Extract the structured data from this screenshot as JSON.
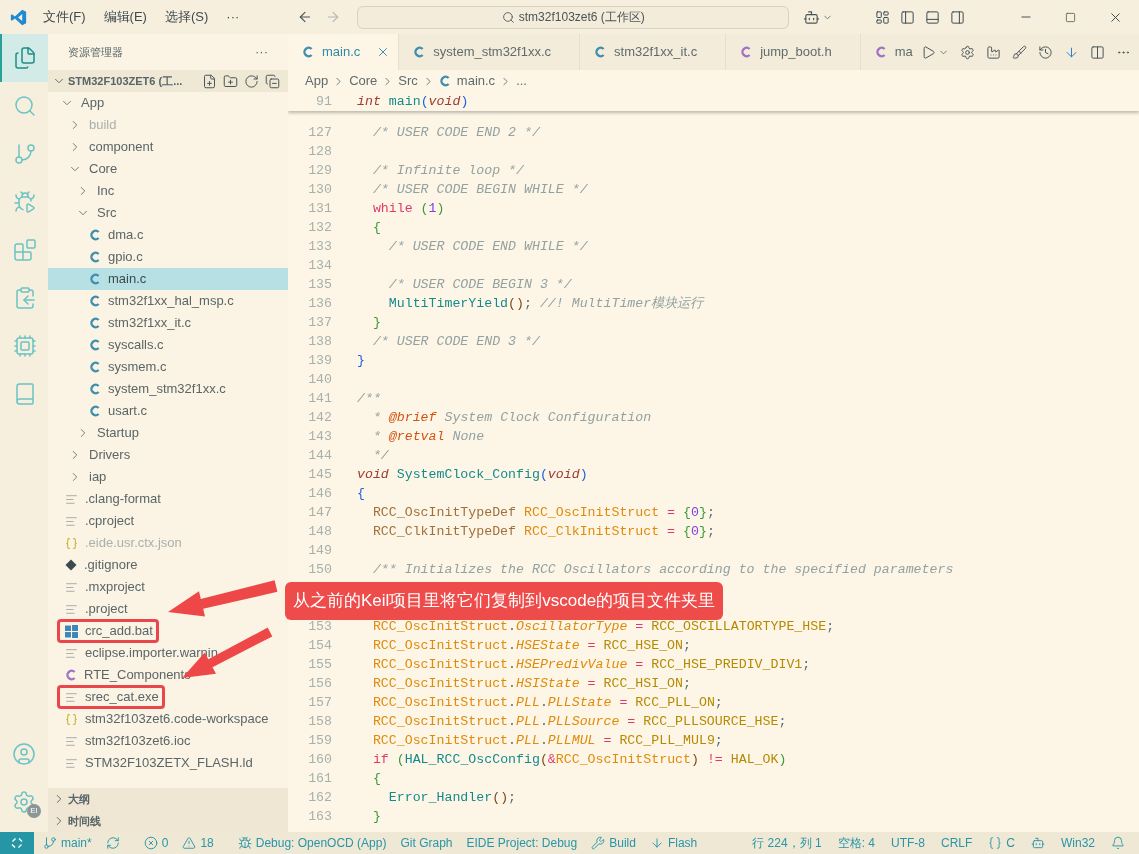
{
  "title_bar": {
    "menus": [
      "文件(F)",
      "编辑(E)",
      "选择(S)",
      "···"
    ],
    "search": "stm32f103zet6 (工作区)"
  },
  "activity_bar": [
    {
      "kind": "explorer",
      "selected": true
    },
    {
      "kind": "search",
      "selected": false
    },
    {
      "kind": "source-control",
      "selected": false
    },
    {
      "kind": "run-debug",
      "selected": false
    },
    {
      "kind": "extensions",
      "selected": false
    },
    {
      "kind": "transfer",
      "selected": false
    },
    {
      "kind": "chip",
      "selected": false
    },
    {
      "kind": "book",
      "selected": false
    }
  ],
  "activity_bottom": [
    {
      "kind": "account"
    },
    {
      "kind": "settings",
      "badge": "EI"
    }
  ],
  "sidebar": {
    "title": "资源管理器",
    "more": "···",
    "project": "STM32F103ZET6 (工...",
    "tree": [
      {
        "label": "App",
        "kind": "folder",
        "expanded": true,
        "selected": false,
        "dimmed": false,
        "highlighted": false,
        "children": [
          {
            "label": "build",
            "kind": "folder",
            "expanded": false,
            "selected": false,
            "dimmed": true,
            "highlighted": false
          },
          {
            "label": "component",
            "kind": "folder",
            "expanded": false,
            "selected": false,
            "dimmed": false,
            "highlighted": false
          },
          {
            "label": "Core",
            "kind": "folder",
            "expanded": true,
            "selected": false,
            "dimmed": false,
            "highlighted": false,
            "children": [
              {
                "label": "Inc",
                "kind": "folder",
                "expanded": false,
                "selected": false,
                "dimmed": false,
                "highlighted": false
              },
              {
                "label": "Src",
                "kind": "folder",
                "expanded": true,
                "selected": false,
                "dimmed": false,
                "highlighted": false,
                "children": [
                  {
                    "label": "dma.c",
                    "kind": "c",
                    "selected": false,
                    "dimmed": false,
                    "highlighted": false
                  },
                  {
                    "label": "gpio.c",
                    "kind": "c",
                    "selected": false,
                    "dimmed": false,
                    "highlighted": false
                  },
                  {
                    "label": "main.c",
                    "kind": "c",
                    "selected": true,
                    "dimmed": false,
                    "highlighted": false
                  },
                  {
                    "label": "stm32f1xx_hal_msp.c",
                    "kind": "c",
                    "selected": false,
                    "dimmed": false,
                    "highlighted": false
                  },
                  {
                    "label": "stm32f1xx_it.c",
                    "kind": "c",
                    "selected": false,
                    "dimmed": false,
                    "highlighted": false
                  },
                  {
                    "label": "syscalls.c",
                    "kind": "c",
                    "selected": false,
                    "dimmed": false,
                    "highlighted": false
                  },
                  {
                    "label": "sysmem.c",
                    "kind": "c",
                    "selected": false,
                    "dimmed": false,
                    "highlighted": false
                  },
                  {
                    "label": "system_stm32f1xx.c",
                    "kind": "c",
                    "selected": false,
                    "dimmed": false,
                    "highlighted": false
                  },
                  {
                    "label": "usart.c",
                    "kind": "c",
                    "selected": false,
                    "dimmed": false,
                    "highlighted": false
                  }
                ]
              },
              {
                "label": "Startup",
                "kind": "folder",
                "expanded": false,
                "selected": false,
                "dimmed": false,
                "highlighted": false
              }
            ]
          },
          {
            "label": "Drivers",
            "kind": "folder",
            "expanded": false,
            "selected": false,
            "dimmed": false,
            "highlighted": false
          },
          {
            "label": "iap",
            "kind": "folder",
            "expanded": false,
            "selected": false,
            "dimmed": false,
            "highlighted": false
          }
        ]
      },
      {
        "label": ".clang-format",
        "kind": "text",
        "selected": false,
        "dimmed": false,
        "highlighted": false
      },
      {
        "label": ".cproject",
        "kind": "text",
        "selected": false,
        "dimmed": false,
        "highlighted": false
      },
      {
        "label": ".eide.usr.ctx.json",
        "kind": "json",
        "selected": false,
        "dimmed": true,
        "highlighted": false
      },
      {
        "label": ".gitignore",
        "kind": "git",
        "selected": false,
        "dimmed": false,
        "highlighted": false
      },
      {
        "label": ".mxproject",
        "kind": "text",
        "selected": false,
        "dimmed": false,
        "highlighted": false
      },
      {
        "label": ".project",
        "kind": "text",
        "selected": false,
        "dimmed": false,
        "highlighted": false
      },
      {
        "label": "crc_add.bat",
        "kind": "windows",
        "selected": false,
        "dimmed": false,
        "highlighted": true
      },
      {
        "label": "eclipse.importer.warnin",
        "kind": "text",
        "selected": false,
        "dimmed": false,
        "highlighted": false
      },
      {
        "label": "RTE_Components",
        "kind": "h",
        "selected": false,
        "dimmed": false,
        "highlighted": false
      },
      {
        "label": "srec_cat.exe",
        "kind": "text",
        "selected": false,
        "dimmed": false,
        "highlighted": true
      },
      {
        "label": "stm32f103zet6.code-workspace",
        "kind": "json",
        "selected": false,
        "dimmed": false,
        "highlighted": false
      },
      {
        "label": "stm32f103zet6.ioc",
        "kind": "text",
        "selected": false,
        "dimmed": false,
        "highlighted": false
      },
      {
        "label": "STM32F103ZETX_FLASH.ld",
        "kind": "text",
        "selected": false,
        "dimmed": false,
        "highlighted": false
      }
    ],
    "sections": [
      {
        "label": "大纲",
        "expanded": false
      },
      {
        "label": "时间线",
        "expanded": false
      }
    ]
  },
  "tabs": [
    {
      "label": "main.c",
      "kind": "c",
      "selected": true
    },
    {
      "label": "system_stm32f1xx.c",
      "kind": "c",
      "selected": false
    },
    {
      "label": "stm32f1xx_it.c",
      "kind": "c",
      "selected": false
    },
    {
      "label": "jump_boot.h",
      "kind": "h",
      "selected": false
    },
    {
      "label": "ma",
      "kind": "h",
      "selected": false
    }
  ],
  "breadcrumbs": [
    {
      "label": "App",
      "kind": "folder"
    },
    {
      "label": "Core",
      "kind": "folder"
    },
    {
      "label": "Src",
      "kind": "folder"
    },
    {
      "label": "main.c",
      "kind": "c"
    },
    {
      "label": "...",
      "kind": "folder"
    }
  ],
  "editor": {
    "sticky": {
      "number": "91",
      "tokens": [
        {
          "text": "int",
          "kind": "storage"
        },
        {
          "text": " main",
          "kind": "function"
        },
        {
          "text": "(",
          "kind": "bracket1"
        },
        {
          "text": "void",
          "kind": "storage"
        },
        {
          "text": ")",
          "kind": "bracket1"
        }
      ]
    },
    "lines": [
      {
        "number": "127",
        "tokens": [
          {
            "text": "  /* USER CODE END 2 */",
            "kind": "comment"
          }
        ]
      },
      {
        "number": "128"
      },
      {
        "number": "129",
        "tokens": [
          {
            "text": "  /* Infinite loop */",
            "kind": "comment"
          }
        ]
      },
      {
        "number": "130",
        "tokens": [
          {
            "text": "  /* USER CODE BEGIN WHILE */",
            "kind": "comment"
          }
        ]
      },
      {
        "number": "131",
        "tokens": [
          {
            "text": "  while",
            "kind": "keyword"
          },
          {
            "text": " (",
            "kind": "bracket2"
          },
          {
            "text": "1",
            "kind": "number"
          },
          {
            "text": ")",
            "kind": "bracket2"
          }
        ]
      },
      {
        "number": "132",
        "tokens": [
          {
            "text": "  {",
            "kind": "bracket2"
          }
        ]
      },
      {
        "number": "133",
        "tokens": [
          {
            "text": "    /* USER CODE END WHILE */",
            "kind": "comment"
          }
        ]
      },
      {
        "number": "134"
      },
      {
        "number": "135",
        "tokens": [
          {
            "text": "    /* USER CODE BEGIN 3 */",
            "kind": "comment"
          }
        ]
      },
      {
        "number": "136",
        "tokens": [
          {
            "text": "    MultiTimerYield",
            "kind": "function"
          },
          {
            "text": "()",
            "kind": "bracket3"
          },
          {
            "text": ";",
            "kind": "plain"
          },
          {
            "text": " //! MultiTimer模块运行",
            "kind": "comment"
          }
        ]
      },
      {
        "number": "137",
        "tokens": [
          {
            "text": "  }",
            "kind": "bracket2"
          }
        ]
      },
      {
        "number": "138",
        "tokens": [
          {
            "text": "  /* USER CODE END 3 */",
            "kind": "comment"
          }
        ]
      },
      {
        "number": "139",
        "tokens": [
          {
            "text": "}",
            "kind": "bracket1"
          }
        ]
      },
      {
        "number": "140"
      },
      {
        "number": "141",
        "tokens": [
          {
            "text": "/**",
            "kind": "comment"
          }
        ]
      },
      {
        "number": "142",
        "tokens": [
          {
            "text": "  * ",
            "kind": "comment"
          },
          {
            "text": "@brief",
            "kind": "doctag"
          },
          {
            "text": " System Clock Configuration",
            "kind": "comment"
          }
        ]
      },
      {
        "number": "143",
        "tokens": [
          {
            "text": "  * ",
            "kind": "comment"
          },
          {
            "text": "@retval",
            "kind": "doctag"
          },
          {
            "text": " None",
            "kind": "comment"
          }
        ]
      },
      {
        "number": "144",
        "tokens": [
          {
            "text": "  */",
            "kind": "comment"
          }
        ]
      },
      {
        "number": "145",
        "tokens": [
          {
            "text": "void",
            "kind": "storage"
          },
          {
            "text": " SystemClock_Config",
            "kind": "function"
          },
          {
            "text": "(",
            "kind": "bracket1"
          },
          {
            "text": "void",
            "kind": "storage"
          },
          {
            "text": ")",
            "kind": "bracket1"
          }
        ]
      },
      {
        "number": "146",
        "tokens": [
          {
            "text": "{",
            "kind": "bracket1"
          }
        ]
      },
      {
        "number": "147",
        "tokens": [
          {
            "text": "  RCC_OscInitTypeDef",
            "kind": "type"
          },
          {
            "text": " RCC_OscInitStruct",
            "kind": "variable"
          },
          {
            "text": " =",
            "kind": "operator"
          },
          {
            "text": " {",
            "kind": "bracket2"
          },
          {
            "text": "0",
            "kind": "number"
          },
          {
            "text": "}",
            "kind": "bracket2"
          },
          {
            "text": ";",
            "kind": "plain"
          }
        ]
      },
      {
        "number": "148",
        "tokens": [
          {
            "text": "  RCC_ClkInitTypeDef",
            "kind": "type"
          },
          {
            "text": " RCC_ClkInitStruct",
            "kind": "variable"
          },
          {
            "text": " =",
            "kind": "operator"
          },
          {
            "text": " {",
            "kind": "bracket2"
          },
          {
            "text": "0",
            "kind": "number"
          },
          {
            "text": "}",
            "kind": "bracket2"
          },
          {
            "text": ";",
            "kind": "plain"
          }
        ]
      },
      {
        "number": "149"
      },
      {
        "number": "150",
        "tokens": [
          {
            "text": "  /** Initializes the RCC Oscillators according to the specified parameters",
            "kind": "comment"
          }
        ]
      },
      {
        "number": "153",
        "tokens": [
          {
            "text": "  RCC_OscInitStruct",
            "kind": "variable"
          },
          {
            "text": ".",
            "kind": "plain"
          },
          {
            "text": "OscillatorType",
            "kind": "property"
          },
          {
            "text": " =",
            "kind": "operator"
          },
          {
            "text": " RCC_OSCILLATORTYPE_HSE",
            "kind": "constant"
          },
          {
            "text": ";",
            "kind": "plain"
          }
        ]
      },
      {
        "number": "154",
        "tokens": [
          {
            "text": "  RCC_OscInitStruct",
            "kind": "variable"
          },
          {
            "text": ".",
            "kind": "plain"
          },
          {
            "text": "HSEState",
            "kind": "property"
          },
          {
            "text": " =",
            "kind": "operator"
          },
          {
            "text": " RCC_HSE_ON",
            "kind": "constant"
          },
          {
            "text": ";",
            "kind": "plain"
          }
        ]
      },
      {
        "number": "155",
        "tokens": [
          {
            "text": "  RCC_OscInitStruct",
            "kind": "variable"
          },
          {
            "text": ".",
            "kind": "plain"
          },
          {
            "text": "HSEPredivValue",
            "kind": "property"
          },
          {
            "text": " =",
            "kind": "operator"
          },
          {
            "text": " RCC_HSE_PREDIV_DIV1",
            "kind": "constant"
          },
          {
            "text": ";",
            "kind": "plain"
          }
        ]
      },
      {
        "number": "156",
        "tokens": [
          {
            "text": "  RCC_OscInitStruct",
            "kind": "variable"
          },
          {
            "text": ".",
            "kind": "plain"
          },
          {
            "text": "HSIState",
            "kind": "property"
          },
          {
            "text": " =",
            "kind": "operator"
          },
          {
            "text": " RCC_HSI_ON",
            "kind": "constant"
          },
          {
            "text": ";",
            "kind": "plain"
          }
        ]
      },
      {
        "number": "157",
        "tokens": [
          {
            "text": "  RCC_OscInitStruct",
            "kind": "variable"
          },
          {
            "text": ".",
            "kind": "plain"
          },
          {
            "text": "PLL",
            "kind": "property"
          },
          {
            "text": ".",
            "kind": "plain"
          },
          {
            "text": "PLLState",
            "kind": "property"
          },
          {
            "text": " =",
            "kind": "operator"
          },
          {
            "text": " RCC_PLL_ON",
            "kind": "constant"
          },
          {
            "text": ";",
            "kind": "plain"
          }
        ]
      },
      {
        "number": "158",
        "tokens": [
          {
            "text": "  RCC_OscInitStruct",
            "kind": "variable"
          },
          {
            "text": ".",
            "kind": "plain"
          },
          {
            "text": "PLL",
            "kind": "property"
          },
          {
            "text": ".",
            "kind": "plain"
          },
          {
            "text": "PLLSource",
            "kind": "property"
          },
          {
            "text": " =",
            "kind": "operator"
          },
          {
            "text": " RCC_PLLSOURCE_HSE",
            "kind": "constant"
          },
          {
            "text": ";",
            "kind": "plain"
          }
        ]
      },
      {
        "number": "159",
        "tokens": [
          {
            "text": "  RCC_OscInitStruct",
            "kind": "variable"
          },
          {
            "text": ".",
            "kind": "plain"
          },
          {
            "text": "PLL",
            "kind": "property"
          },
          {
            "text": ".",
            "kind": "plain"
          },
          {
            "text": "PLLMUL",
            "kind": "property"
          },
          {
            "text": " =",
            "kind": "operator"
          },
          {
            "text": " RCC_PLL_MUL9",
            "kind": "constant"
          },
          {
            "text": ";",
            "kind": "plain"
          }
        ]
      },
      {
        "number": "160",
        "tokens": [
          {
            "text": "  if",
            "kind": "keyword"
          },
          {
            "text": " (",
            "kind": "bracket2"
          },
          {
            "text": "HAL_RCC_OscConfig",
            "kind": "function"
          },
          {
            "text": "(",
            "kind": "bracket3"
          },
          {
            "text": "&",
            "kind": "operator"
          },
          {
            "text": "RCC_OscInitStruct",
            "kind": "variable"
          },
          {
            "text": ")",
            "kind": "bracket3"
          },
          {
            "text": " !=",
            "kind": "operator"
          },
          {
            "text": " HAL_OK",
            "kind": "constant"
          },
          {
            "text": ")",
            "kind": "bracket2"
          }
        ]
      },
      {
        "number": "161",
        "tokens": [
          {
            "text": "  {",
            "kind": "bracket2"
          }
        ]
      },
      {
        "number": "162",
        "tokens": [
          {
            "text": "    Error_Handler",
            "kind": "function"
          },
          {
            "text": "()",
            "kind": "bracket3"
          },
          {
            "text": ";",
            "kind": "plain"
          }
        ]
      },
      {
        "number": "163",
        "tokens": [
          {
            "text": "  }",
            "kind": "bracket2"
          }
        ]
      }
    ]
  },
  "annotation": {
    "text": "从之前的Keil项目里将它们复制到vscode的项目文件夹里"
  },
  "status_bar": {
    "left": [
      {
        "kind": "branch",
        "text": "main*"
      },
      {
        "kind": "sync"
      },
      {
        "kind": "errors",
        "text": "0"
      },
      {
        "kind": "warnings",
        "text": "18"
      },
      {
        "kind": "debug",
        "text": "Debug: OpenOCD (App)"
      },
      {
        "kind": "plain",
        "text": "Git Graph"
      },
      {
        "kind": "plain",
        "text": "EIDE Project: Debug"
      },
      {
        "kind": "build",
        "text": "Build"
      },
      {
        "kind": "flash",
        "text": "Flash"
      }
    ],
    "right": [
      {
        "kind": "plain",
        "text": "行 224，列 1"
      },
      {
        "kind": "plain",
        "text": "空格: 4"
      },
      {
        "kind": "plain",
        "text": "UTF-8"
      },
      {
        "kind": "plain",
        "text": "CRLF"
      },
      {
        "kind": "language",
        "text": "C"
      },
      {
        "kind": "copilot"
      },
      {
        "kind": "plain",
        "text": "Win32"
      },
      {
        "kind": "bell"
      }
    ]
  }
}
